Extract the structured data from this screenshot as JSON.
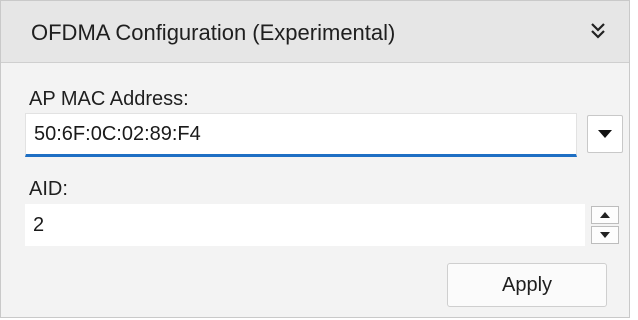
{
  "panel": {
    "title": "OFDMA Configuration (Experimental)",
    "collapse_icon": "double-chevron-down-icon"
  },
  "fields": {
    "ap_mac": {
      "label": "AP MAC Address:",
      "value": "50:6F:0C:02:89:F4",
      "dropdown_icon": "caret-down-icon"
    },
    "aid": {
      "label": "AID:",
      "value": "2",
      "spin_up_icon": "spin-up-icon",
      "spin_down_icon": "spin-down-icon"
    }
  },
  "actions": {
    "apply_label": "Apply"
  },
  "colors": {
    "accent": "#1e6fc4",
    "panel_bg": "#f3f3f3",
    "header_bg": "#e6e6e6"
  }
}
